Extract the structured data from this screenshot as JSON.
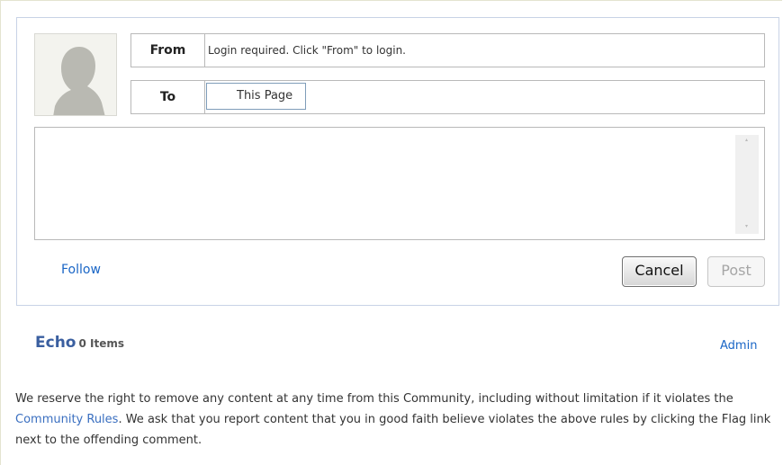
{
  "compose": {
    "from_label": "From",
    "from_value": "Login required. Click \"From\" to login.",
    "to_label": "To",
    "to_value": "This Page",
    "follow_label": "Follow",
    "cancel_label": "Cancel",
    "post_label": "Post"
  },
  "echo": {
    "title": "Echo",
    "count": "0 Items",
    "admin_label": "Admin"
  },
  "notice": {
    "text_before": "We reserve the right to remove any content at any time from this Community, including without limitation if it violates the ",
    "link_text": "Community Rules",
    "text_after": ". We ask that you report content that you in good faith believe violates the above rules by clicking the Flag link next to the offending comment."
  },
  "colors": {
    "link": "#1a66c6",
    "echo_title": "#3a5fa0",
    "compose_border": "#c8d3e6"
  },
  "icons": {
    "avatar": "default-user-silhouette"
  }
}
